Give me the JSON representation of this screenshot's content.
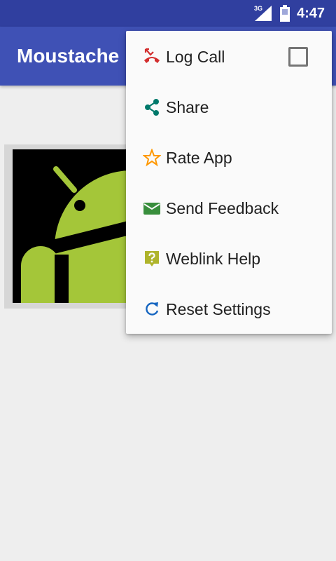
{
  "status_bar": {
    "network_type": "3G",
    "time": "4:47",
    "icons": [
      "signal-icon",
      "battery-icon"
    ]
  },
  "app_bar": {
    "title": "Moustache"
  },
  "colors": {
    "status_bar": "#303f9f",
    "app_bar": "#3f51b5",
    "background": "#eeeeee",
    "menu_background": "#fafafa"
  },
  "overflow_menu": {
    "items": [
      {
        "label": "Log Call",
        "icon": "call-missed-icon",
        "icon_color": "#d32f2f",
        "checkbox": true,
        "checked": false
      },
      {
        "label": "Share",
        "icon": "share-icon",
        "icon_color": "#00796b"
      },
      {
        "label": "Rate App",
        "icon": "star-outline-icon",
        "icon_color": "#ff9800"
      },
      {
        "label": "Send Feedback",
        "icon": "email-icon",
        "icon_color": "#388e3c"
      },
      {
        "label": "Weblink Help",
        "icon": "help-icon",
        "icon_color": "#afb42b"
      },
      {
        "label": "Reset Settings",
        "icon": "refresh-icon",
        "icon_color": "#1565c0"
      }
    ]
  },
  "content": {
    "image": "android-robot-image"
  }
}
